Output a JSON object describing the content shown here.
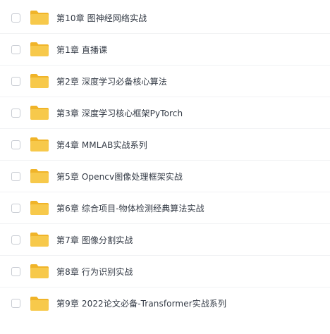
{
  "folder_color": "#f7c94b",
  "folder_tab_color": "#f0b429",
  "files": [
    {
      "name": "第10章 图神经网络实战",
      "icon": "folder-icon"
    },
    {
      "name": "第1章 直播课",
      "icon": "folder-icon"
    },
    {
      "name": "第2章 深度学习必备核心算法",
      "icon": "folder-icon"
    },
    {
      "name": "第3章 深度学习核心框架PyTorch",
      "icon": "folder-icon"
    },
    {
      "name": "第4章 MMLAB实战系列",
      "icon": "folder-icon"
    },
    {
      "name": "第5章 Opencv图像处理框架实战",
      "icon": "folder-icon"
    },
    {
      "name": "第6章 综合项目-物体检测经典算法实战",
      "icon": "folder-icon"
    },
    {
      "name": "第7章 图像分割实战",
      "icon": "folder-icon"
    },
    {
      "name": "第8章 行为识别实战",
      "icon": "folder-icon"
    },
    {
      "name": "第9章 2022论文必备-Transformer实战系列",
      "icon": "folder-icon"
    }
  ]
}
